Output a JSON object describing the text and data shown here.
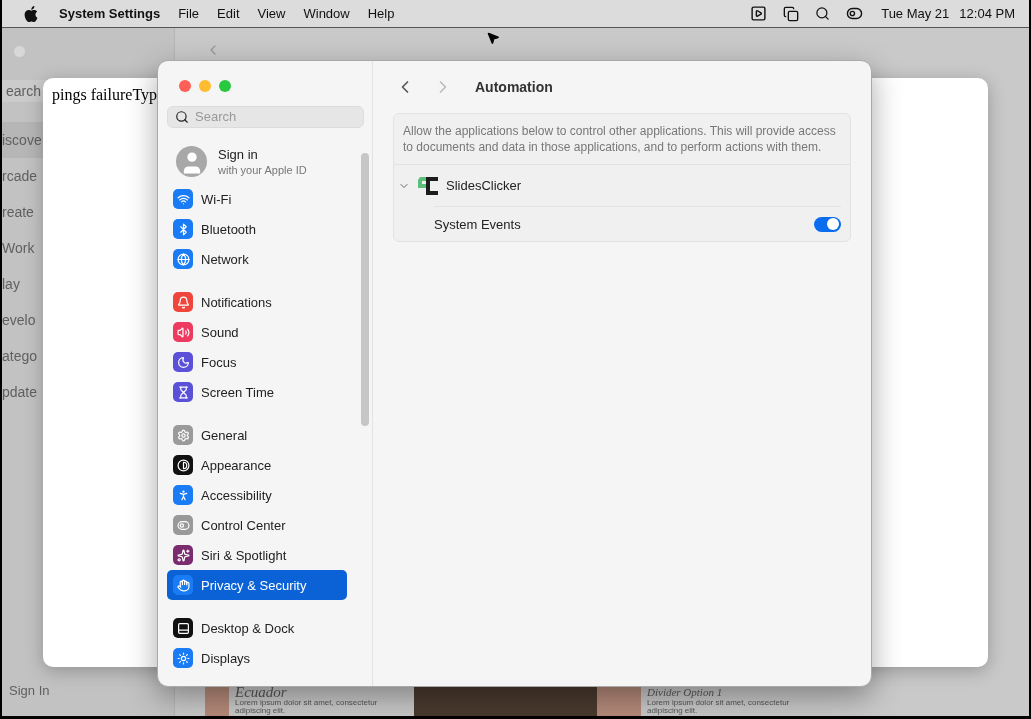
{
  "menu_bar": {
    "app_name": "System Settings",
    "menus": [
      "File",
      "Edit",
      "View",
      "Window",
      "Help"
    ],
    "date": "Tue May 21",
    "time": "12:04 PM"
  },
  "background_app": {
    "search_placeholder": "earch",
    "sidebar_items": [
      {
        "label": "iscove",
        "selected": true
      },
      {
        "label": "rcade",
        "selected": false
      },
      {
        "label": "reate",
        "selected": false
      },
      {
        "label": "Work",
        "selected": false
      },
      {
        "label": "lay",
        "selected": false
      },
      {
        "label": "evelo",
        "selected": false
      },
      {
        "label": "atego",
        "selected": false
      },
      {
        "label": "pdate",
        "selected": false
      }
    ],
    "sign_in": "Sign In",
    "thumbnails": [
      {
        "kind": "card",
        "title": "Ecuador",
        "caption": "Lorem ipsum dolor sit amet, consectetur adipiscing elit."
      },
      {
        "kind": "photo"
      },
      {
        "kind": "card",
        "title": "Divider Option 1",
        "caption": "Lorem ipsum dolor sit amet, consectetur adipiscing elit."
      }
    ]
  },
  "dialog": {
    "text": "pings failureTyp"
  },
  "settings": {
    "search": {
      "placeholder": "Search"
    },
    "account": {
      "title": "Sign in",
      "subtitle": "with your Apple ID"
    },
    "sidebar_groups": [
      [
        {
          "label": "Wi-Fi",
          "kind": "wifi",
          "selected": false
        },
        {
          "label": "Bluetooth",
          "kind": "bluetooth",
          "selected": false
        },
        {
          "label": "Network",
          "kind": "network",
          "selected": false
        }
      ],
      [
        {
          "label": "Notifications",
          "kind": "notifications",
          "selected": false
        },
        {
          "label": "Sound",
          "kind": "sound",
          "selected": false
        },
        {
          "label": "Focus",
          "kind": "focus",
          "selected": false
        },
        {
          "label": "Screen Time",
          "kind": "screentime",
          "selected": false
        }
      ],
      [
        {
          "label": "General",
          "kind": "general",
          "selected": false
        },
        {
          "label": "Appearance",
          "kind": "appearance",
          "selected": false
        },
        {
          "label": "Accessibility",
          "kind": "accessibility",
          "selected": false
        },
        {
          "label": "Control Center",
          "kind": "controlcenter",
          "selected": false
        },
        {
          "label": "Siri & Spotlight",
          "kind": "siri",
          "selected": false
        },
        {
          "label": "Privacy & Security",
          "kind": "privacy",
          "selected": true
        }
      ],
      [
        {
          "label": "Desktop & Dock",
          "kind": "dock",
          "selected": false
        },
        {
          "label": "Displays",
          "kind": "displays",
          "selected": false
        }
      ]
    ],
    "header": {
      "back_enabled": true,
      "forward_enabled": false,
      "title": "Automation"
    },
    "description": "Allow the applications below to control other applications. This will provide access to documents and data in those applications, and to perform actions with them.",
    "apps": [
      {
        "name": "SlidesClicker",
        "expanded": true,
        "targets": [
          {
            "name": "System Events",
            "on": true
          }
        ]
      }
    ]
  }
}
